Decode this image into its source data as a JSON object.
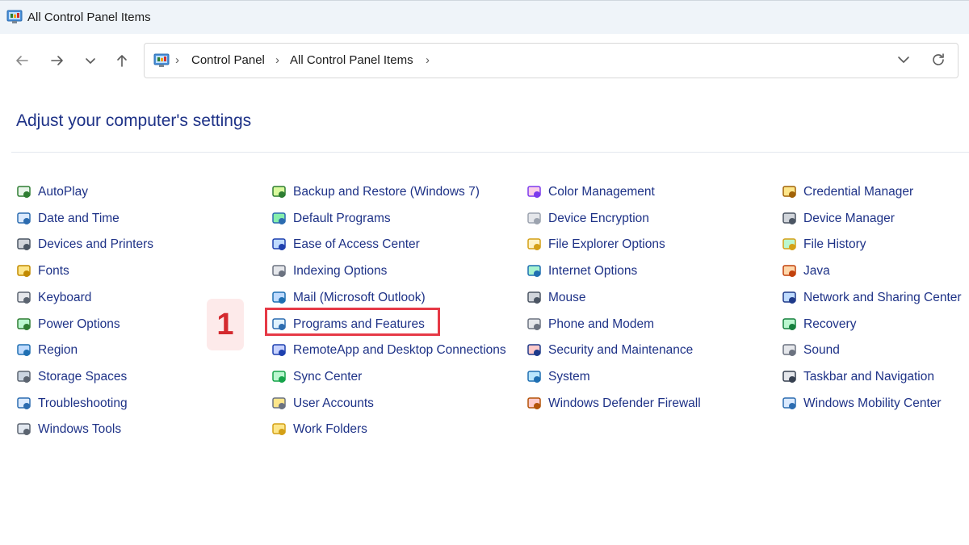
{
  "window": {
    "title": "All Control Panel Items"
  },
  "nav": {
    "back_icon": "arrow-left-icon",
    "forward_icon": "arrow-right-icon",
    "recent_icon": "chevron-down-icon",
    "up_icon": "arrow-up-icon"
  },
  "address": {
    "breadcrumbs": [
      "Control Panel",
      "All Control Panel Items"
    ],
    "sep": "›",
    "dropdown_icon": "chevron-down-icon",
    "refresh_icon": "refresh-icon"
  },
  "main": {
    "heading": "Adjust your computer's settings"
  },
  "columns": [
    [
      {
        "label": "AutoPlay",
        "icon": "autoplay-icon"
      },
      {
        "label": "Date and Time",
        "icon": "date-time-icon"
      },
      {
        "label": "Devices and Printers",
        "icon": "printer-icon"
      },
      {
        "label": "Fonts",
        "icon": "fonts-icon"
      },
      {
        "label": "Keyboard",
        "icon": "keyboard-icon"
      },
      {
        "label": "Power Options",
        "icon": "power-icon"
      },
      {
        "label": "Region",
        "icon": "globe-icon"
      },
      {
        "label": "Storage Spaces",
        "icon": "storage-icon"
      },
      {
        "label": "Troubleshooting",
        "icon": "troubleshoot-icon"
      },
      {
        "label": "Windows Tools",
        "icon": "tools-icon"
      }
    ],
    [
      {
        "label": "Backup and Restore (Windows 7)",
        "icon": "backup-icon"
      },
      {
        "label": "Default Programs",
        "icon": "default-programs-icon"
      },
      {
        "label": "Ease of Access Center",
        "icon": "accessibility-icon"
      },
      {
        "label": "Indexing Options",
        "icon": "indexing-icon"
      },
      {
        "label": "Mail (Microsoft Outlook)",
        "icon": "mail-icon"
      },
      {
        "label": "Programs and Features",
        "icon": "programs-icon"
      },
      {
        "label": "RemoteApp and Desktop Connections",
        "icon": "remote-desktop-icon"
      },
      {
        "label": "Sync Center",
        "icon": "sync-icon"
      },
      {
        "label": "User Accounts",
        "icon": "users-icon"
      },
      {
        "label": "Work Folders",
        "icon": "folder-icon"
      }
    ],
    [
      {
        "label": "Color Management",
        "icon": "color-icon"
      },
      {
        "label": "Device Encryption",
        "icon": "key-icon"
      },
      {
        "label": "File Explorer Options",
        "icon": "folder-options-icon"
      },
      {
        "label": "Internet Options",
        "icon": "internet-icon"
      },
      {
        "label": "Mouse",
        "icon": "mouse-icon"
      },
      {
        "label": "Phone and Modem",
        "icon": "phone-icon"
      },
      {
        "label": "Security and Maintenance",
        "icon": "flag-icon"
      },
      {
        "label": "System",
        "icon": "monitor-icon"
      },
      {
        "label": "Windows Defender Firewall",
        "icon": "firewall-icon"
      }
    ],
    [
      {
        "label": "Credential Manager",
        "icon": "credential-icon"
      },
      {
        "label": "Device Manager",
        "icon": "device-manager-icon"
      },
      {
        "label": "File History",
        "icon": "file-history-icon"
      },
      {
        "label": "Java",
        "icon": "java-icon"
      },
      {
        "label": "Network and Sharing Center",
        "icon": "network-icon"
      },
      {
        "label": "Recovery",
        "icon": "recovery-icon"
      },
      {
        "label": "Sound",
        "icon": "speaker-icon"
      },
      {
        "label": "Taskbar and Navigation",
        "icon": "taskbar-icon"
      },
      {
        "label": "Windows Mobility Center",
        "icon": "mobility-icon"
      }
    ]
  ],
  "annotation": {
    "step": "1",
    "highlight_color": "#e63946"
  },
  "colors": {
    "link": "#1e3287",
    "titlebar": "#eff4f9"
  }
}
